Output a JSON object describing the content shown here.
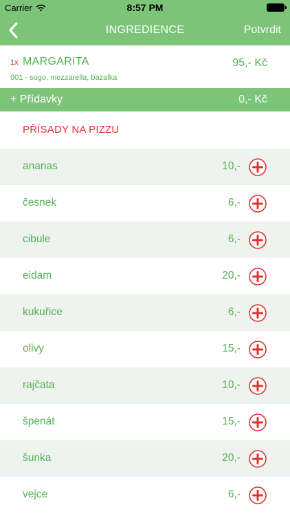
{
  "status_bar": {
    "carrier": "Carrier",
    "time": "8:57 PM",
    "wifi_icon": "wifi-icon",
    "battery_icon": "battery-icon"
  },
  "nav": {
    "back_icon": "chevron-left-icon",
    "title": "INGREDIENCE",
    "confirm_label": "Potvrdit"
  },
  "order_item": {
    "quantity": "1x",
    "name": "MARGARITA",
    "description": "001 - sugo, mozzarella, bazalka",
    "price": "95,- Kč"
  },
  "extras": {
    "label": "+ Přídavky",
    "price": "0,- Kč"
  },
  "section_title": "PŘÍSADY NA PIZZU",
  "ingredients": [
    {
      "name": "ananas",
      "price": "10,-"
    },
    {
      "name": "česnek",
      "price": "6,-"
    },
    {
      "name": "cibule",
      "price": "6,-"
    },
    {
      "name": "eidam",
      "price": "20,-"
    },
    {
      "name": "kukuřice",
      "price": "6,-"
    },
    {
      "name": "olivy",
      "price": "15,-"
    },
    {
      "name": "rajčata",
      "price": "10,-"
    },
    {
      "name": "špenát",
      "price": "15,-"
    },
    {
      "name": "šunka",
      "price": "20,-"
    },
    {
      "name": "vejce",
      "price": "6,-"
    }
  ],
  "colors": {
    "header_green": "#7cc478",
    "text_green": "#55b055",
    "accent_red": "#e0312f",
    "row_alt": "#eef3ef"
  }
}
